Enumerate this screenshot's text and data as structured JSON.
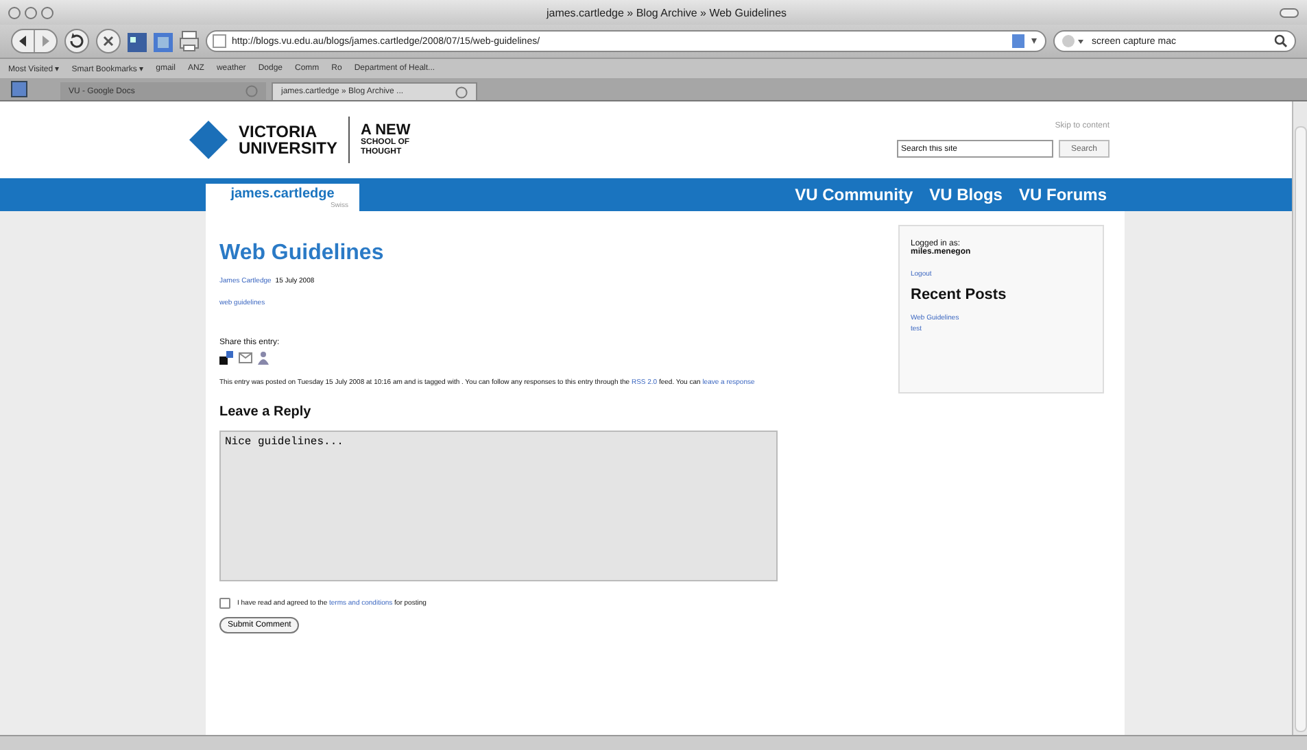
{
  "window": {
    "title": "james.cartledge » Blog Archive » Web Guidelines"
  },
  "toolbar": {
    "url": "http://blogs.vu.edu.au/blogs/james.cartledge/2008/07/15/web-guidelines/",
    "search": "screen capture mac"
  },
  "bookmarks": [
    "Most Visited ▾",
    "Smart Bookmarks ▾",
    "gmail",
    "ANZ",
    "weather",
    "Dodge",
    "Comm",
    "Ro",
    "Department of Healt..."
  ],
  "tabs": [
    {
      "label": "VU - Google Docs",
      "selected": false
    },
    {
      "label": "james.cartledge » Blog Archive ...",
      "selected": true
    }
  ],
  "site": {
    "logo_name": [
      "VICTORIA",
      "UNIVERSITY"
    ],
    "tagline": [
      "A NEW",
      "SCHOOL OF",
      "THOUGHT"
    ],
    "skip_link": "Skip to content",
    "search_placeholder": "Search this site",
    "search_button": "Search"
  },
  "nav": {
    "blog_name": "james.cartledge",
    "blog_sub": "Swiss",
    "links": [
      "VU Community",
      "VU Blogs",
      "VU Forums"
    ]
  },
  "post": {
    "title": "Web Guidelines",
    "author": "James Cartledge",
    "date": "15 July 2008",
    "tag": "web guidelines",
    "share_label": "Share this entry:",
    "footer": [
      {
        "text": "This entry was posted on Tuesday 15 July 2008 at 10:16 am and is tagged with . You can follow any responses to this entry through the",
        "link": false
      },
      {
        "text": "RSS 2.0",
        "link": true
      },
      {
        "text": "feed. You can",
        "link": false
      },
      {
        "text": "leave a response",
        "link": true
      }
    ]
  },
  "reply": {
    "heading": "Leave a Reply",
    "value": "Nice guidelines...",
    "agree_checked": false,
    "agree_before": "I have read and agreed to the",
    "agree_link": "terms and conditions",
    "agree_after": "for posting",
    "submit": "Submit Comment"
  },
  "sidebar": {
    "logged_label": "Logged in as:",
    "user": "miles.menegon",
    "logout": "Logout",
    "recent_heading": "Recent Posts",
    "recent": [
      "Web Guidelines",
      "test"
    ]
  }
}
